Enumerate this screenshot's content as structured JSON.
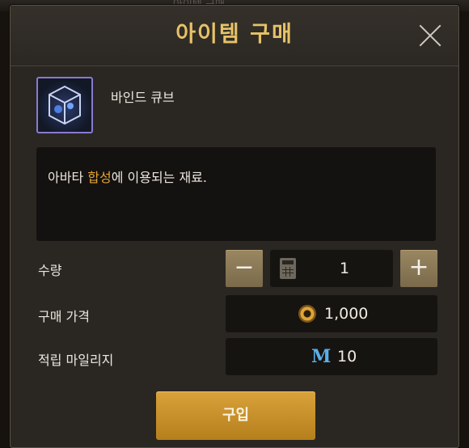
{
  "background": {
    "text": "아이템 구매"
  },
  "dialog": {
    "title": "아이템 구매",
    "close_icon": "close-icon"
  },
  "item": {
    "name": "바인드 큐브",
    "icon": "bind-cube-icon",
    "description_before": "아바타 ",
    "description_highlight": "합성",
    "description_after": "에 이용되는 재료."
  },
  "quantity": {
    "label": "수량",
    "minus": "−",
    "plus": "+",
    "value": "1",
    "calculator_icon": "calculator-icon"
  },
  "price": {
    "label": "구매 가격",
    "currency_icon": "coin-icon",
    "value": "1,000"
  },
  "mileage": {
    "label": "적립 마일리지",
    "icon_glyph": "M",
    "value": "10"
  },
  "buy_button": {
    "label": "구입"
  },
  "colors": {
    "accent_gold": "#e6c268",
    "highlight": "#e6a436",
    "buy_button": "#c8902a",
    "mileage_blue": "#5ab0e8"
  }
}
